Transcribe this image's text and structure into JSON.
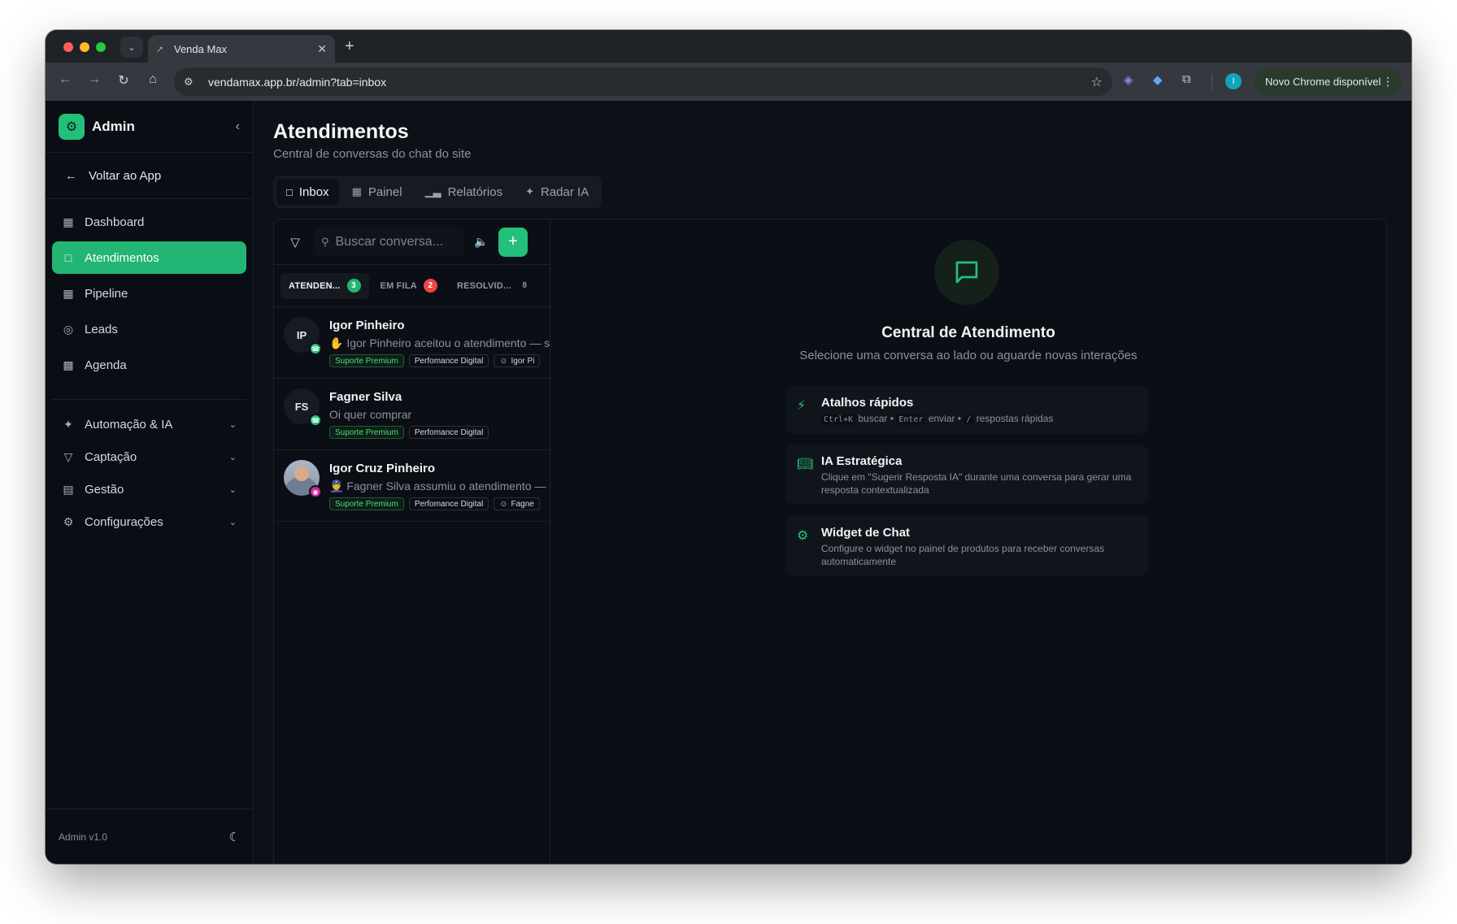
{
  "browser": {
    "tab_title": "Venda Max",
    "url": "vendamax.app.br/admin?tab=inbox",
    "profile_initial": "I",
    "update_label": "Novo Chrome disponível"
  },
  "sidebar": {
    "title": "Admin",
    "back_label": "Voltar ao App",
    "nav": [
      {
        "label": "Dashboard",
        "icon": "grid-icon"
      },
      {
        "label": "Atendimentos",
        "icon": "message-icon",
        "active": true
      },
      {
        "label": "Pipeline",
        "icon": "grid-icon"
      },
      {
        "label": "Leads",
        "icon": "target-icon"
      },
      {
        "label": "Agenda",
        "icon": "calendar-icon"
      }
    ],
    "groups": [
      {
        "label": "Automação & IA",
        "icon": "sparkles-icon"
      },
      {
        "label": "Captação",
        "icon": "filter-icon"
      },
      {
        "label": "Gestão",
        "icon": "briefcase-icon"
      },
      {
        "label": "Configurações",
        "icon": "gear-icon"
      }
    ],
    "version": "Admin v1.0"
  },
  "main": {
    "title": "Atendimentos",
    "subtitle": "Central de conversas do chat do site",
    "tabs": [
      {
        "label": "Inbox",
        "icon": "message-icon",
        "active": true
      },
      {
        "label": "Painel",
        "icon": "grid-icon"
      },
      {
        "label": "Relatórios",
        "icon": "bar-chart-icon"
      },
      {
        "label": "Radar IA",
        "icon": "sparkles-icon"
      }
    ]
  },
  "inbox": {
    "search_placeholder": "Buscar conversa...",
    "status_tabs": [
      {
        "label": "ATENDEN...",
        "count": "3",
        "active": true
      },
      {
        "label": "EM FILA",
        "count": "2"
      },
      {
        "label": "RESOLVID...",
        "count": "8"
      }
    ],
    "conversations": [
      {
        "initials": "IP",
        "name": "Igor Pinheiro",
        "message": "✋ Igor Pinheiro aceitou o atendimento — s",
        "channel": "whatsapp",
        "tags": [
          "Suporte Premium",
          "Perfomance Digital"
        ],
        "assignee": "Igor Pi"
      },
      {
        "initials": "FS",
        "name": "Fagner Silva",
        "message": "Oi quer comprar",
        "channel": "whatsapp",
        "tags": [
          "Suporte Premium",
          "Perfomance Digital"
        ],
        "assignee": ""
      },
      {
        "initials": "",
        "name": "Igor Cruz Pinheiro",
        "message": "👮 Fagner Silva assumiu o atendimento —",
        "channel": "instagram",
        "tags": [
          "Suporte Premium",
          "Perfomance Digital"
        ],
        "assignee": "Fagne"
      }
    ]
  },
  "detail": {
    "title": "Central de Atendimento",
    "subtitle": "Selecione uma conversa ao lado ou aguarde novas interações",
    "cards": [
      {
        "title": "Atalhos rápidos",
        "icon": "lightning-icon"
      },
      {
        "title": "IA Estratégica",
        "icon": "book-icon",
        "description": "Clique em \"Sugerir Resposta IA\" durante uma conversa para gerar uma resposta contextualizada"
      },
      {
        "title": "Widget de Chat",
        "icon": "gear-icon",
        "description": "Configure o widget no painel de produtos para receber conversas automaticamente"
      }
    ],
    "shortcuts": [
      {
        "key": "Ctrl+K",
        "action": "buscar"
      },
      {
        "key": "Enter",
        "action": "enviar"
      },
      {
        "key": "/",
        "action": "respostas rápidas"
      }
    ]
  }
}
